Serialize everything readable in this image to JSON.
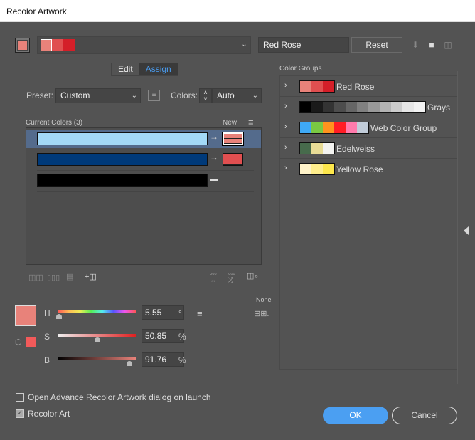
{
  "window": {
    "title": "Recolor Artwork"
  },
  "top": {
    "harmony_colors": [
      "#e8827a",
      "#e04f50",
      "#d41f29"
    ],
    "group_name": "Red Rose",
    "reset_label": "Reset",
    "icons": [
      "save-group-icon",
      "folder-icon",
      "trash-icon"
    ]
  },
  "tabs": [
    {
      "label": "Edit",
      "active": false
    },
    {
      "label": "Assign",
      "active": true
    }
  ],
  "preset": {
    "label": "Preset:",
    "value": "Custom"
  },
  "colors": {
    "label": "Colors:",
    "value": "Auto"
  },
  "current_colors": {
    "label": "Current Colors (3)",
    "new_label": "New",
    "rows": [
      {
        "current": "#a3d9f7",
        "new": [
          "#e8827a",
          "#e8827a"
        ],
        "selected": true
      },
      {
        "current": "#003a7a",
        "new": [
          "#e04f50",
          "#e04f50"
        ],
        "selected": false
      },
      {
        "current": "#000000",
        "new": null,
        "selected": false
      }
    ]
  },
  "hsb": {
    "H": {
      "label": "H",
      "value": "5.55",
      "unit": "°",
      "fraction": 0.015
    },
    "S": {
      "label": "S",
      "value": "50.85",
      "unit": "%",
      "fraction": 0.5085
    },
    "B": {
      "label": "B",
      "value": "91.76",
      "unit": "%",
      "fraction": 0.9176
    },
    "swatch_color": "#e8827a",
    "gamut_color": "#f25a5a"
  },
  "none_label": "None",
  "color_groups": {
    "label": "Color Groups",
    "items": [
      {
        "name": "Red Rose",
        "colors": [
          "#e8827a",
          "#e04f50",
          "#d41f29"
        ]
      },
      {
        "name": "Grays",
        "colors": [
          "#000000",
          "#1a1a1a",
          "#333333",
          "#4d4d4d",
          "#666666",
          "#808080",
          "#999999",
          "#b3b3b3",
          "#cccccc",
          "#e6e6e6",
          "#f2f2f2"
        ]
      },
      {
        "name": "Web Color Group",
        "colors": [
          "#3fa9f5",
          "#7ac943",
          "#ff931e",
          "#ff1d25",
          "#ff7bac",
          "#c1ccd9"
        ]
      },
      {
        "name": "Edelweiss",
        "colors": [
          "#476b4c",
          "#e8dc96",
          "#f3f3f0"
        ]
      },
      {
        "name": "Yellow Rose",
        "colors": [
          "#fff3c9",
          "#ffee8c",
          "#fde74c"
        ]
      }
    ]
  },
  "options": {
    "open_advance": {
      "label": "Open Advance Recolor Artwork dialog on launch",
      "checked": false
    },
    "recolor_art": {
      "label": "Recolor Art",
      "checked": true
    }
  },
  "buttons": {
    "ok": "OK",
    "cancel": "Cancel"
  }
}
